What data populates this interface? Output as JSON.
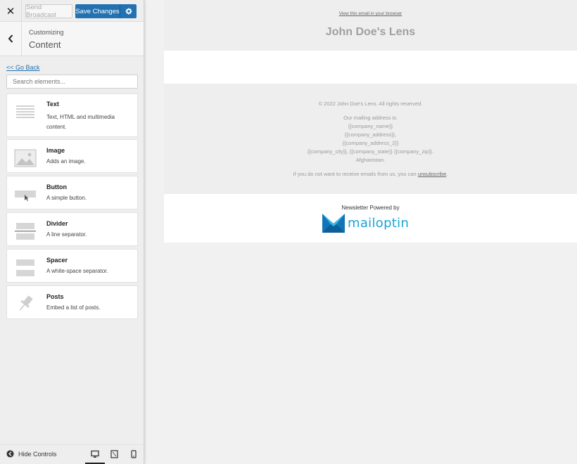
{
  "topbar": {
    "close_glyph": "✕",
    "send_broadcast_label": "Send Broadcast",
    "save_changes_label": "Save Changes"
  },
  "customizer": {
    "label": "Customizing",
    "title": "Content"
  },
  "go_back_label": "<< Go Back",
  "search": {
    "placeholder": "Search elements..."
  },
  "elements": [
    {
      "title": "Text",
      "description": "Text, HTML and multimedia content.",
      "icon": "text-lines-icon"
    },
    {
      "title": "Image",
      "description": "Adds an image.",
      "icon": "image-icon"
    },
    {
      "title": "Button",
      "description": "A simple button.",
      "icon": "button-icon"
    },
    {
      "title": "Divider",
      "description": "A line separator.",
      "icon": "divider-icon"
    },
    {
      "title": "Spacer",
      "description": "A white-space separator.",
      "icon": "spacer-icon"
    },
    {
      "title": "Posts",
      "description": "Embed a list of posts.",
      "icon": "pin-icon"
    }
  ],
  "bottom_bar": {
    "hide_controls_label": "Hide Controls",
    "devices": [
      "desktop",
      "tablet",
      "mobile"
    ],
    "active_device": "desktop"
  },
  "preview": {
    "view_in_browser": "View this email in your browser",
    "brand_title": "John Doe's Lens",
    "copyright": "© 2022 John Doe's Lens. All rights reserved.",
    "mailing_label": "Our mailing address is:",
    "address_lines": [
      "{{company_name}}",
      "{{company_address}},",
      "{{company_address_2}}",
      "{{company_city}}, {{company_state}} {{company_zip}}.",
      "Afghanistan."
    ],
    "unsubscribe_prefix": "If you do not want to receive emails from us, you can ",
    "unsubscribe_link": "unsubscribe",
    "unsubscribe_suffix": ".",
    "powered_by": "Newsletter Powered by",
    "logo_text": "mailoptin"
  },
  "colors": {
    "primary_blue": "#2271b1",
    "logo_blue": "#1aa3d6",
    "sidebar_bg": "#eeeeee",
    "preview_bg": "#eeeeee"
  }
}
